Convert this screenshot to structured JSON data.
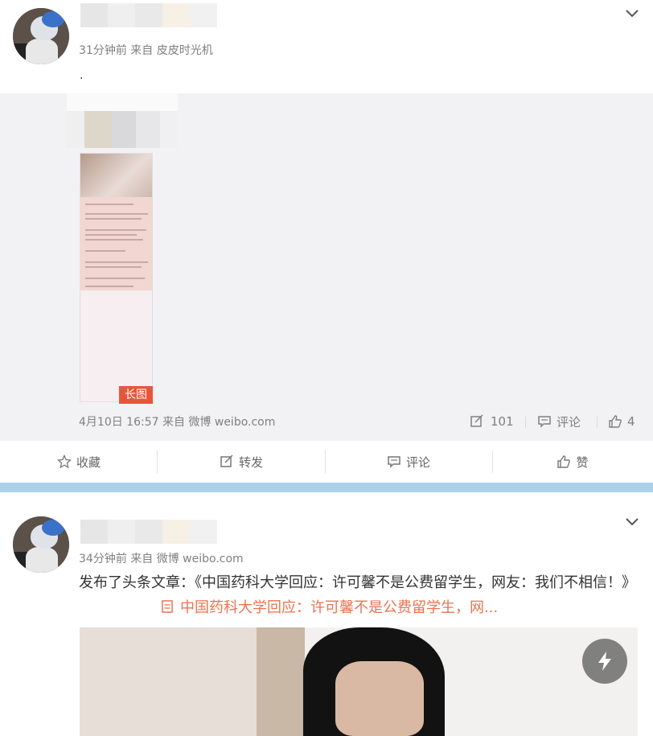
{
  "post1": {
    "meta": "31分钟前 来自 皮皮时光机",
    "text": ".",
    "long_image_badge": "长图",
    "retweet": {
      "meta": "4月10日 16:57 来自 微博 weibo.com",
      "reposts": "101",
      "comments": "评论",
      "likes": "4"
    },
    "actions": {
      "favorite": "收藏",
      "repost": "转发",
      "comment": "评论",
      "like": "赞"
    }
  },
  "post2": {
    "meta": "34分钟前 来自 微博 weibo.com",
    "text": "发布了头条文章：《中国药科大学回应：许可馨不是公费留学生，网友：我们不相信！》",
    "article_link": "中国药科大学回应：许可馨不是公费留学生，网..."
  },
  "icons": {
    "expand": "chevron-down-icon",
    "repost": "repost-icon",
    "comment": "comment-icon",
    "like": "thumbs-up-icon",
    "favorite": "star-icon",
    "article": "article-icon",
    "flash": "lightning-icon"
  },
  "colors": {
    "link": "#eb7350",
    "badge": "#e8553d",
    "divider": "#a9d1e9",
    "retweet_bg": "#f2f2f5"
  }
}
